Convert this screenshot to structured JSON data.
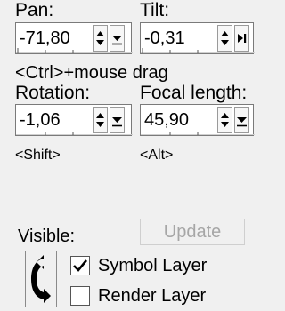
{
  "pan": {
    "label": "Pan:",
    "value": "-71,80"
  },
  "tilt": {
    "label": "Tilt:",
    "value": "-0,31"
  },
  "ctrl_hint": "<Ctrl>+mouse drag",
  "rotation": {
    "label": "Rotation:",
    "value": "-1,06"
  },
  "focal_length": {
    "label": "Focal length:",
    "value": "45,90"
  },
  "shift_hint": "<Shift>",
  "alt_hint": "<Alt>",
  "visible_label": "Visible:",
  "update_label": "Update",
  "layers": [
    {
      "label": "Symbol Layer",
      "checked": true
    },
    {
      "label": "Render Layer",
      "checked": false
    }
  ],
  "icons": [
    "spin-up-icon",
    "spin-down-icon",
    "step-forward-icon",
    "swap-arrows-icon",
    "checkmark-icon"
  ]
}
